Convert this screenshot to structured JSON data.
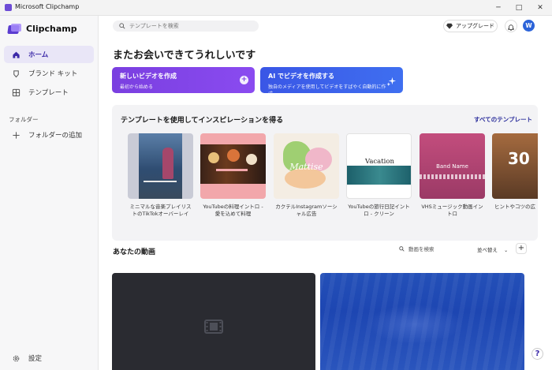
{
  "window": {
    "title": "Microsoft Clipchamp",
    "minimize": "─",
    "maximize": "□",
    "close": "✕"
  },
  "app": {
    "name": "Clipchamp"
  },
  "sidebar": {
    "items": [
      {
        "label": "ホーム",
        "icon": "home-icon"
      },
      {
        "label": "ブランド キット",
        "icon": "brand-kit-icon"
      },
      {
        "label": "テンプレート",
        "icon": "template-icon"
      }
    ],
    "folders_section": "フォルダー",
    "add_folder": "フォルダーの追加",
    "settings": "設定"
  },
  "header": {
    "search_placeholder": "テンプレートを検索",
    "upgrade": "アップグレード",
    "avatar_initial": "W"
  },
  "welcome": "またお会いできてうれしいです",
  "cta": [
    {
      "title": "新しいビデオを作成",
      "subtitle": "最初から始める"
    },
    {
      "title": "AI でビデオを作成する",
      "subtitle": "独自のメディアを使用してビデオをすばやく自動的に作成..."
    }
  ],
  "templates": {
    "title": "テンプレートを使用してインスピレーションを得る",
    "view_all": "すべてのテンプレート",
    "items": [
      {
        "name": "ミニマルな音楽プレイリストのTikTokオーバーレイ"
      },
      {
        "name": "YouTubeの料理イントロ - 愛を込めて料理"
      },
      {
        "name": "カクテルInstagramソーシャル広告",
        "thumb_text": "Mattise"
      },
      {
        "name": "YouTubeの旅行日記イントロ - クリーン",
        "thumb_text": "Vacation"
      },
      {
        "name": "VHSミュージック動画イントロ",
        "thumb_text": "Band Name"
      },
      {
        "name": "ヒントやコツの広",
        "thumb_text": "30"
      }
    ]
  },
  "videos": {
    "title": "あなたの動画",
    "search_placeholder": "動画を検索",
    "sort": "並べ替え",
    "add": "+"
  },
  "help": "?",
  "colors": {
    "accent": "#5b3dd0",
    "cta_purple": "#7a3fe0",
    "cta_blue": "#3a56e6",
    "video_blue": "#1d46b2"
  }
}
